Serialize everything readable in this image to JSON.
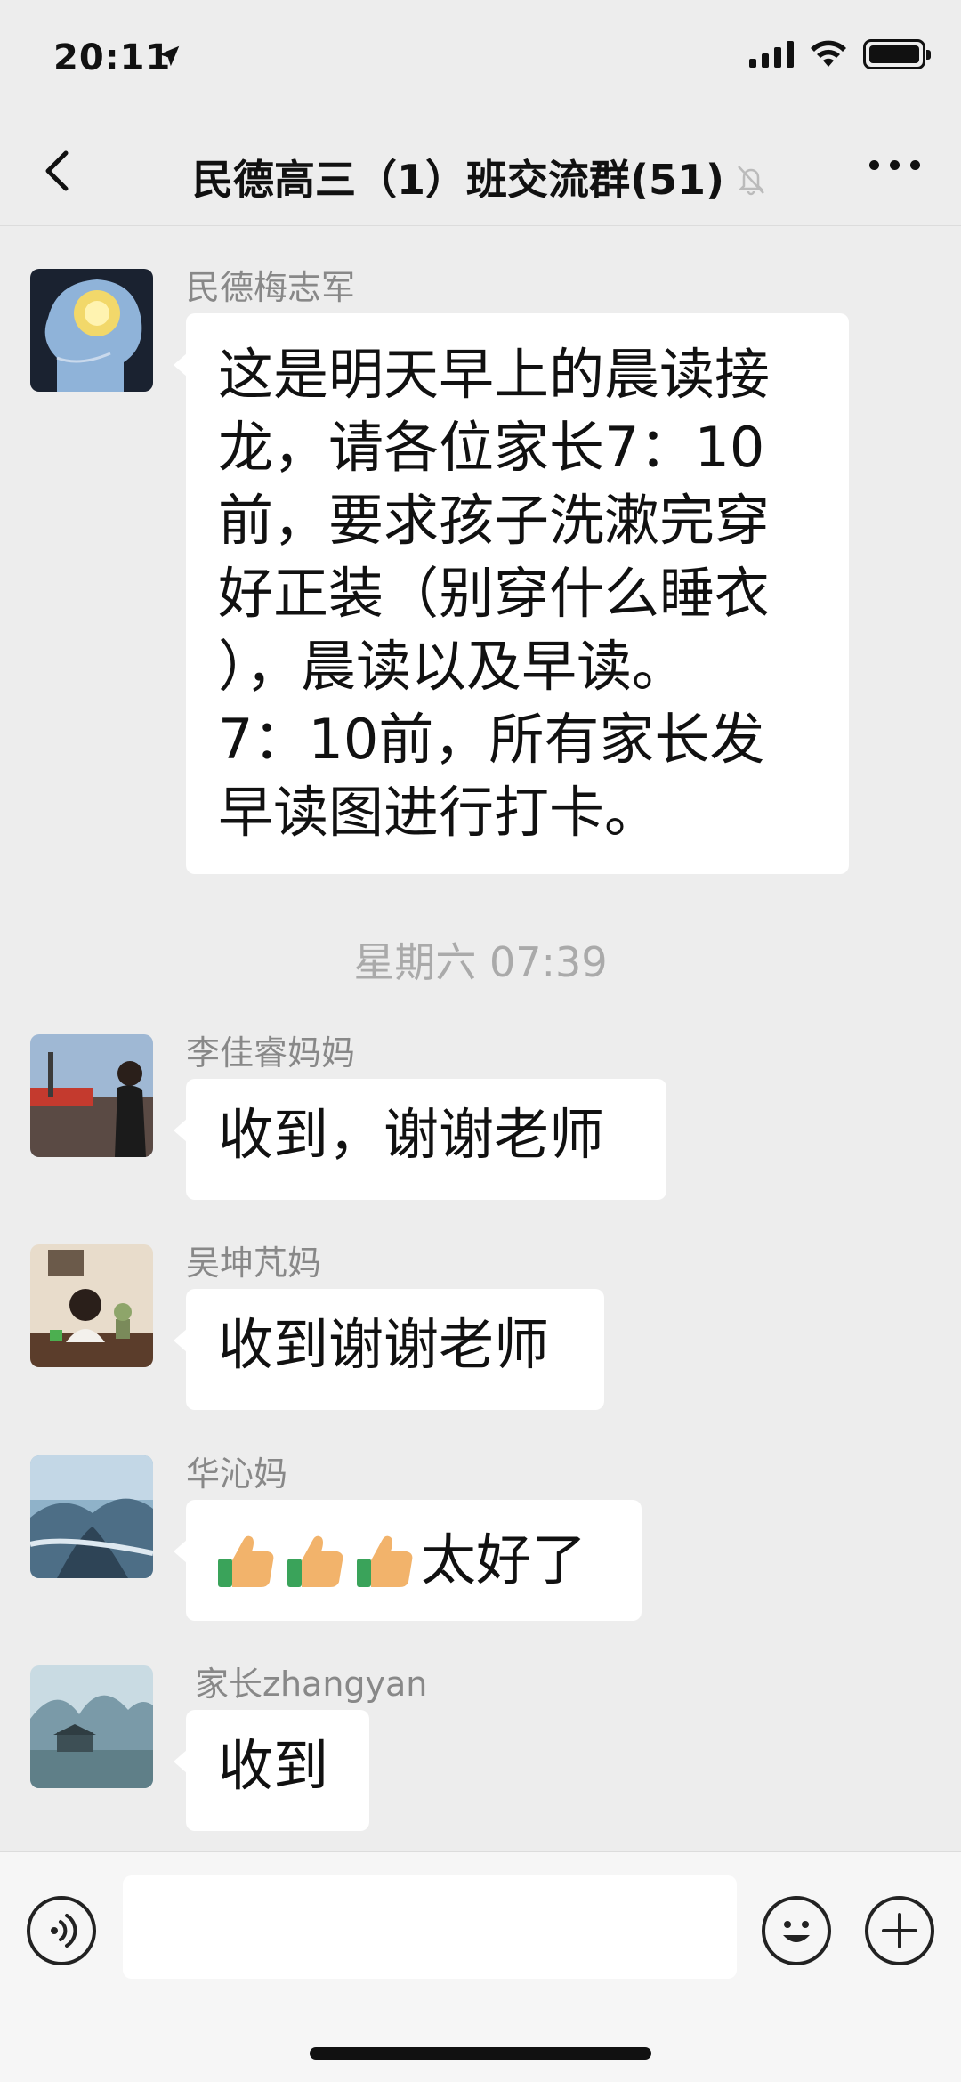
{
  "status_bar": {
    "time": "20:11"
  },
  "nav": {
    "title": "民德高三（1）班交流群(51)"
  },
  "timestamp": "星期六 07:39",
  "messages": [
    {
      "sender": "民德梅志军",
      "lines": [
        "这是明天早上的晨读接",
        "龙，请各位家长7：10",
        "前，要求孩子洗漱完穿",
        "好正装（别穿什么睡衣",
        "），晨读以及早读。",
        "7：10前，所有家长发",
        "早读图进行打卡。"
      ]
    },
    {
      "sender": "李佳睿妈妈",
      "text": "收到，谢谢老师"
    },
    {
      "sender": "吴坤芃妈",
      "text": "收到谢谢老师"
    },
    {
      "sender": "华沁妈",
      "text": "太好了",
      "emoji_prefix": "thumbs-up x3"
    },
    {
      "sender": "家长zhangyan",
      "text": "收到"
    }
  ],
  "input": {
    "placeholder": ""
  },
  "icons": {
    "back": "chevron-left-icon",
    "mute": "bell-muted-icon",
    "more": "more-dots-icon",
    "voice": "voice-icon",
    "emoji": "emoji-icon",
    "plus": "plus-icon"
  }
}
